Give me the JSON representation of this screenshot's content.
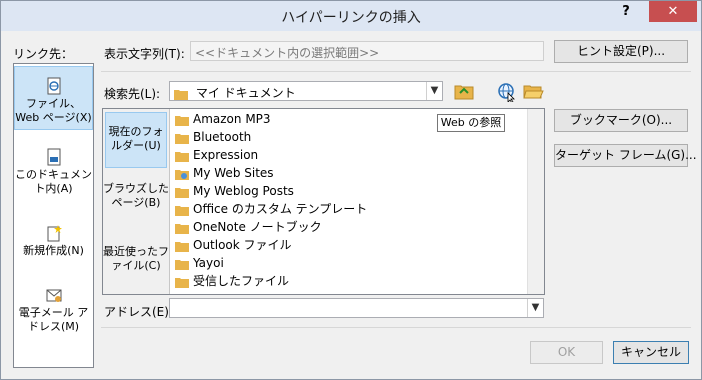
{
  "dialog": {
    "title": "ハイパーリンクの挿入",
    "help_label": "?",
    "close_label": "✕"
  },
  "link_to": {
    "label": "リンク先：",
    "items": [
      {
        "label": "ファイル、Web ページ(X)",
        "selected": true
      },
      {
        "label": "このドキュメント内(A)",
        "selected": false
      },
      {
        "label": "新規作成(N)",
        "selected": false
      },
      {
        "label": "電子メール アドレス(M)",
        "selected": false
      }
    ]
  },
  "display_text": {
    "label": "表示文字列(T):",
    "value": "<<ドキュメント内の選択範囲>>"
  },
  "screentip_button": "ヒント設定(P)...",
  "look_in": {
    "label": "検索先(L):",
    "value": "マイ ドキュメント"
  },
  "tooltip": "Web の参照",
  "browse_options": [
    {
      "label": "現在のフォルダー(U)",
      "selected": true
    },
    {
      "label": "ブラウズしたページ(B)",
      "selected": false
    },
    {
      "label": "最近使ったファイル(C)",
      "selected": false
    }
  ],
  "files": [
    {
      "name": "Amazon MP3",
      "icon": "folder-icon"
    },
    {
      "name": "Bluetooth",
      "icon": "folder-icon"
    },
    {
      "name": "Expression",
      "icon": "folder-icon"
    },
    {
      "name": "My Web Sites",
      "icon": "web-folder-icon"
    },
    {
      "name": "My Weblog Posts",
      "icon": "folder-icon"
    },
    {
      "name": "Office のカスタム テンプレート",
      "icon": "folder-icon"
    },
    {
      "name": "OneNote ノートブック",
      "icon": "folder-icon"
    },
    {
      "name": "Outlook ファイル",
      "icon": "folder-icon"
    },
    {
      "name": "Yayoi",
      "icon": "folder-icon"
    },
    {
      "name": "受信したファイル",
      "icon": "folder-icon"
    }
  ],
  "right_buttons": {
    "bookmark": "ブックマーク(O)...",
    "target_frame": "ターゲット フレーム(G)..."
  },
  "address": {
    "label": "アドレス(E):",
    "value": ""
  },
  "footer": {
    "ok": "OK",
    "cancel": "キャンセル"
  },
  "colors": {
    "titlebar": "#dde6f3",
    "close": "#c74f50",
    "selection": "#cce4f7",
    "folder": "#e8b44a"
  }
}
